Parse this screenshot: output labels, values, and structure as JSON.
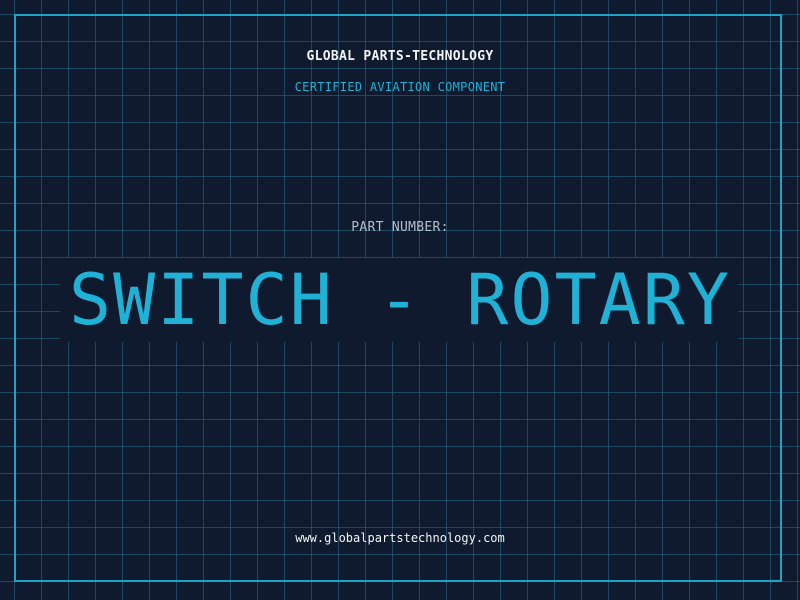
{
  "header": {
    "company": "GLOBAL PARTS-TECHNOLOGY",
    "subtitle": "CERTIFIED AVIATION COMPONENT"
  },
  "part": {
    "label": "PART NUMBER:",
    "value": "SWITCH - ROTARY"
  },
  "footer": {
    "website": "www.globalpartstechnology.com"
  },
  "colors": {
    "background": "#0f1a2e",
    "accent": "#1fb2d6",
    "frame": "#1fa3c4",
    "text": "#f2f4f7",
    "muted": "#b4bfcc"
  }
}
